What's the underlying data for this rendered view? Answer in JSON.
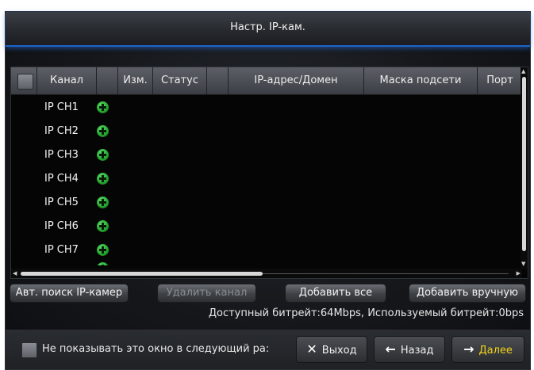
{
  "window": {
    "title": "Настр. IP-кам."
  },
  "table": {
    "columns": [
      "Канал",
      "Изм.",
      "Статус",
      "IP-адрес/Домен",
      "Маска подсети",
      "Порт"
    ],
    "rows": [
      {
        "channel": "IP CH1"
      },
      {
        "channel": "IP CH2"
      },
      {
        "channel": "IP CH3"
      },
      {
        "channel": "IP CH4"
      },
      {
        "channel": "IP CH5"
      },
      {
        "channel": "IP CH6"
      },
      {
        "channel": "IP CH7"
      }
    ],
    "horizontal_scroll_position": 0.0,
    "vertical_scroll_position": 0.0
  },
  "actions": {
    "auto_search": "Авт. поиск IP-камер",
    "delete_channel": "Удалить канал",
    "add_all": "Добавить все",
    "add_manual": "Добавить вручную"
  },
  "status": {
    "bitrate": "Доступный битрейт:64Mbps, Используемый битрейт:0bps"
  },
  "footer": {
    "dont_show_label": "Не показывать это окно в следующий ра:",
    "exit": "Выход",
    "back": "Назад",
    "next": "Далее"
  },
  "colors": {
    "accent_blue": "#1e63c6",
    "next_text": "#f3d21c",
    "add_icon_green": "#22a12d"
  },
  "icons": {
    "row_add": "plus-circle-icon",
    "exit": "close-x-icon",
    "back": "arrow-left-icon",
    "next": "arrow-right-icon"
  }
}
